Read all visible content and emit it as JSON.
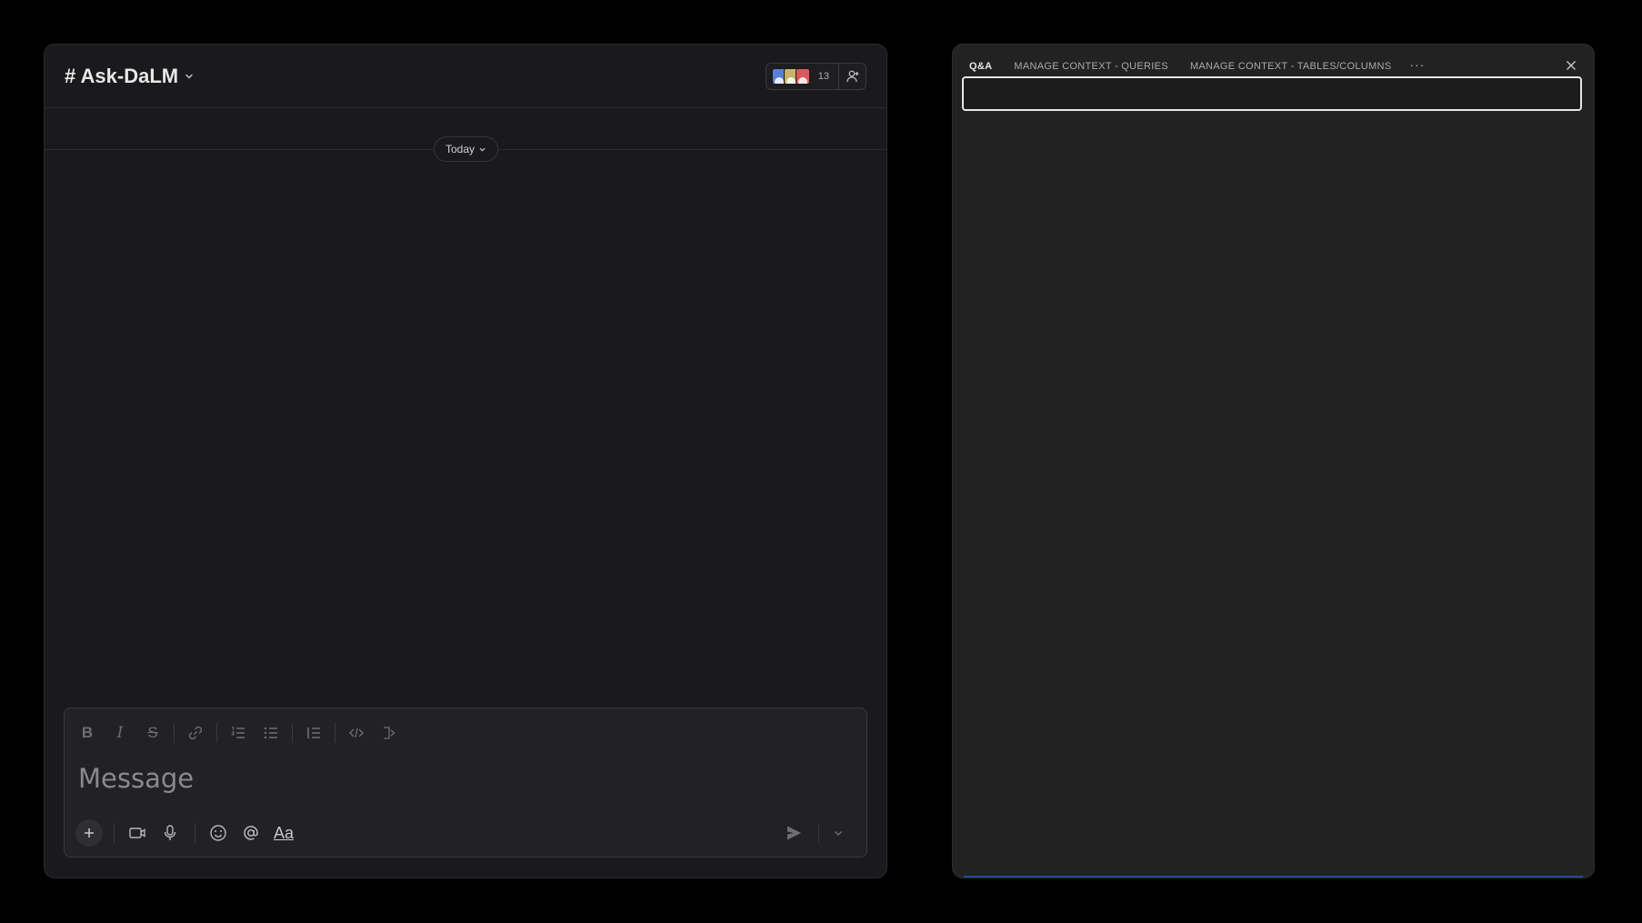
{
  "chat": {
    "channel_name": "# Ask-DaLM",
    "member_count": "13",
    "date_label": "Today",
    "composer": {
      "placeholder": "Message",
      "value": "",
      "format_label": "Aa"
    }
  },
  "colors": {
    "accent_blue": "#1f6feb",
    "avatar_1": "#5b7fd6",
    "avatar_2": "#c9b36a",
    "avatar_3": "#d65a5a"
  },
  "icons": {
    "bold": "bold-icon",
    "italic": "italic-icon",
    "strike": "strikethrough-icon",
    "link": "link-icon",
    "ordered_list": "ordered-list-icon",
    "bullet_list": "bullet-list-icon",
    "blockquote": "blockquote-icon",
    "code": "code-icon",
    "code_block": "code-block-icon",
    "plus": "plus-icon",
    "video": "video-icon",
    "mic": "microphone-icon",
    "emoji": "emoji-icon",
    "mention": "mention-icon",
    "send": "send-icon",
    "close": "close-icon"
  },
  "qa": {
    "tabs": [
      {
        "label": "Q&A",
        "active": true
      },
      {
        "label": "MANAGE CONTEXT - QUERIES",
        "active": false
      },
      {
        "label": "MANAGE CONTEXT - TABLES/COLUMNS",
        "active": false
      }
    ],
    "more_label": "···",
    "input_value": "",
    "input_placeholder": ""
  }
}
